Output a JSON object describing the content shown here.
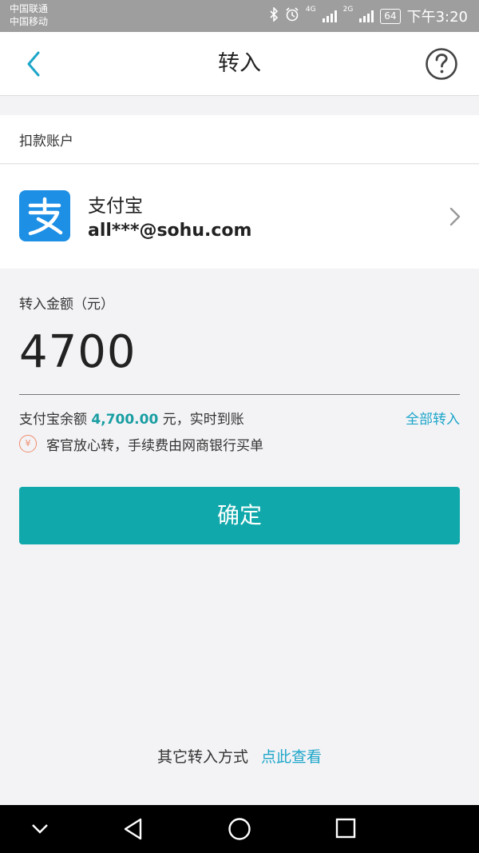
{
  "status_bar": {
    "carrier1": "中国联通",
    "carrier2": "中国移动",
    "net1": "4G",
    "net2": "2G",
    "battery": "64",
    "time": "下午3:20"
  },
  "header": {
    "title": "转入"
  },
  "account_section": {
    "label": "扣款账户",
    "account_name": "支付宝",
    "account_email": "all***@sohu.com"
  },
  "amount": {
    "label": "转入金额（元）",
    "value": "4700"
  },
  "balance": {
    "prefix": "支付宝余额",
    "amount": "4,700.00",
    "suffix": "元，实时到账",
    "all_in_label": "全部转入"
  },
  "notice": {
    "icon_text": "¥",
    "text": "客官放心转，手续费由网商银行买单"
  },
  "confirm_button": {
    "label": "确定"
  },
  "footer": {
    "other_label": "其它转入方式",
    "link_label": "点此查看"
  },
  "colors": {
    "accent": "#10a8aa",
    "link": "#1ea6c9",
    "alipay_blue": "#1d8fe5",
    "notice": "#f08a6a"
  }
}
